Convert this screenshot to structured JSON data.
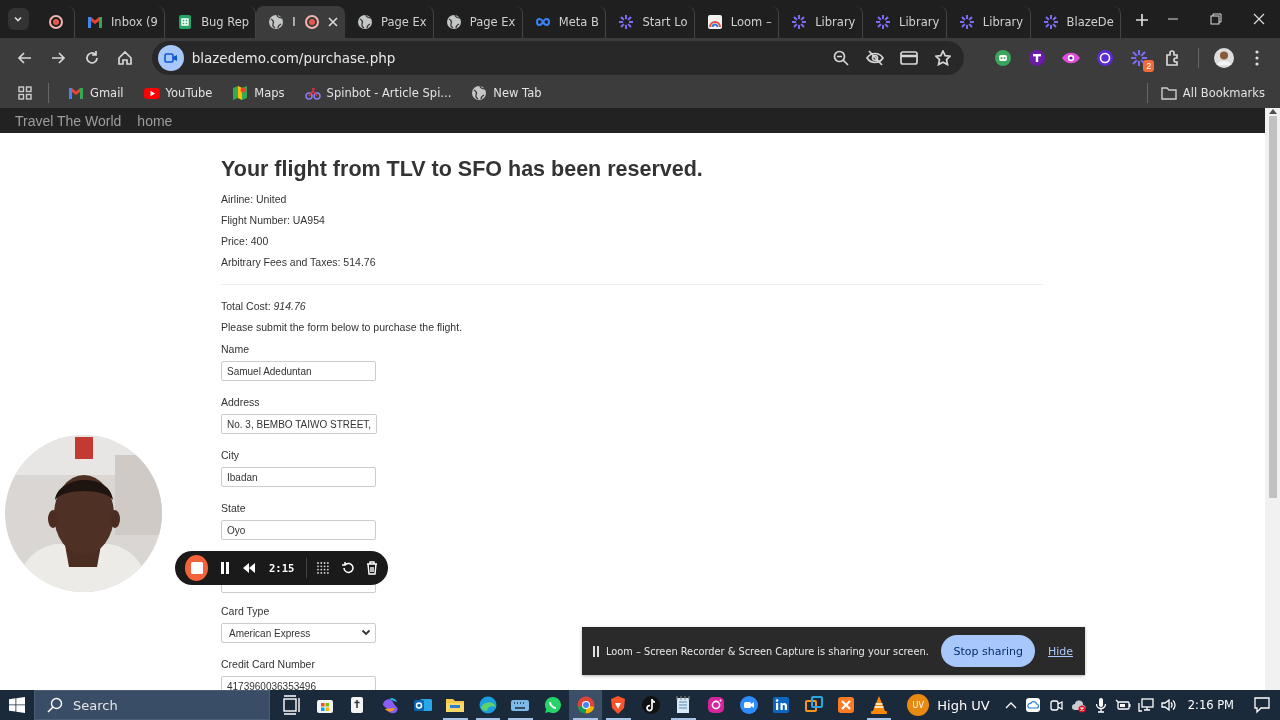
{
  "browser": {
    "tabs": [
      {
        "pinned": true,
        "selected": false,
        "recording": false
      },
      {
        "title": "Inbox (9",
        "pinned": false,
        "selected": false,
        "recording": false
      },
      {
        "title": "Bug Rep",
        "pinned": false,
        "selected": false,
        "recording": false
      },
      {
        "title": "I",
        "pinned": false,
        "selected": true,
        "recording": true
      },
      {
        "title": "Page Ex",
        "pinned": false,
        "selected": false,
        "recording": false
      },
      {
        "title": "Page Ex",
        "pinned": false,
        "selected": false,
        "recording": false
      },
      {
        "title": "Meta B",
        "pinned": false,
        "selected": false,
        "recording": false
      },
      {
        "title": "Start Lo",
        "pinned": false,
        "selected": false,
        "recording": false
      },
      {
        "title": "Loom –",
        "pinned": false,
        "selected": false,
        "recording": false
      },
      {
        "title": "Library",
        "pinned": false,
        "selected": false,
        "recording": false
      },
      {
        "title": "Library",
        "pinned": false,
        "selected": false,
        "recording": false
      },
      {
        "title": "Library",
        "pinned": false,
        "selected": false,
        "recording": false
      },
      {
        "title": "BlazeDe",
        "pinned": false,
        "selected": false,
        "recording": false
      }
    ],
    "address": "blazedemo.com/purchase.php",
    "extension_badge": "2",
    "bookmarks": [
      {
        "label": "Gmail"
      },
      {
        "label": "YouTube"
      },
      {
        "label": "Maps"
      },
      {
        "label": "Spinbot - Article Spi..."
      },
      {
        "label": "New Tab"
      }
    ],
    "all_bookmarks": "All Bookmarks"
  },
  "page": {
    "nav": [
      "Travel The World",
      "home"
    ],
    "heading": "Your flight from TLV to SFO has been reserved.",
    "details": [
      "Airline: United",
      "Flight Number: UA954",
      "Price: 400",
      "Arbitrary Fees and Taxes: 514.76"
    ],
    "total": "Total Cost: *914.76*",
    "instruction": "Please submit the form below to purchase the flight.",
    "fields": [
      {
        "kind": "input",
        "label": "Name",
        "value": "Samuel Adeduntan"
      },
      {
        "kind": "input",
        "label": "Address",
        "value": "No. 3, BEMBO TAIWO STREET,"
      },
      {
        "kind": "input",
        "label": "City",
        "value": "Ibadan"
      },
      {
        "kind": "input",
        "label": "State",
        "value": "Oyo"
      },
      {
        "kind": "covered-input"
      },
      {
        "kind": "select",
        "label": "Card Type",
        "value": "American Express"
      },
      {
        "kind": "input",
        "label": "Credit Card Number",
        "value": "4173960036353496"
      }
    ]
  },
  "recorder": {
    "time": "2:15"
  },
  "share_notice": {
    "message": "Loom – Screen Recorder & Screen Capture is sharing your screen.",
    "stop_button": "Stop sharing",
    "hide_link": "Hide"
  },
  "taskbar": {
    "search_placeholder": "Search",
    "apps": [
      {
        "running": false,
        "focused": false
      },
      {
        "running": false,
        "focused": false
      },
      {
        "running": false,
        "focused": false
      },
      {
        "running": false,
        "focused": false
      },
      {
        "running": false,
        "focused": false
      },
      {
        "running": true,
        "focused": false
      },
      {
        "running": true,
        "focused": false
      },
      {
        "running": true,
        "focused": false
      },
      {
        "running": false,
        "focused": false
      },
      {
        "running": true,
        "focused": true
      },
      {
        "running": true,
        "focused": false
      },
      {
        "running": false,
        "focused": false
      },
      {
        "running": true,
        "focused": false
      },
      {
        "running": false,
        "focused": false
      },
      {
        "running": false,
        "focused": false
      },
      {
        "running": false,
        "focused": false
      },
      {
        "running": false,
        "focused": false
      },
      {
        "running": false,
        "focused": false
      },
      {
        "running": true,
        "focused": false
      }
    ],
    "weather_badge": "UV",
    "weather": "High UV",
    "clock": "2:16 PM"
  }
}
